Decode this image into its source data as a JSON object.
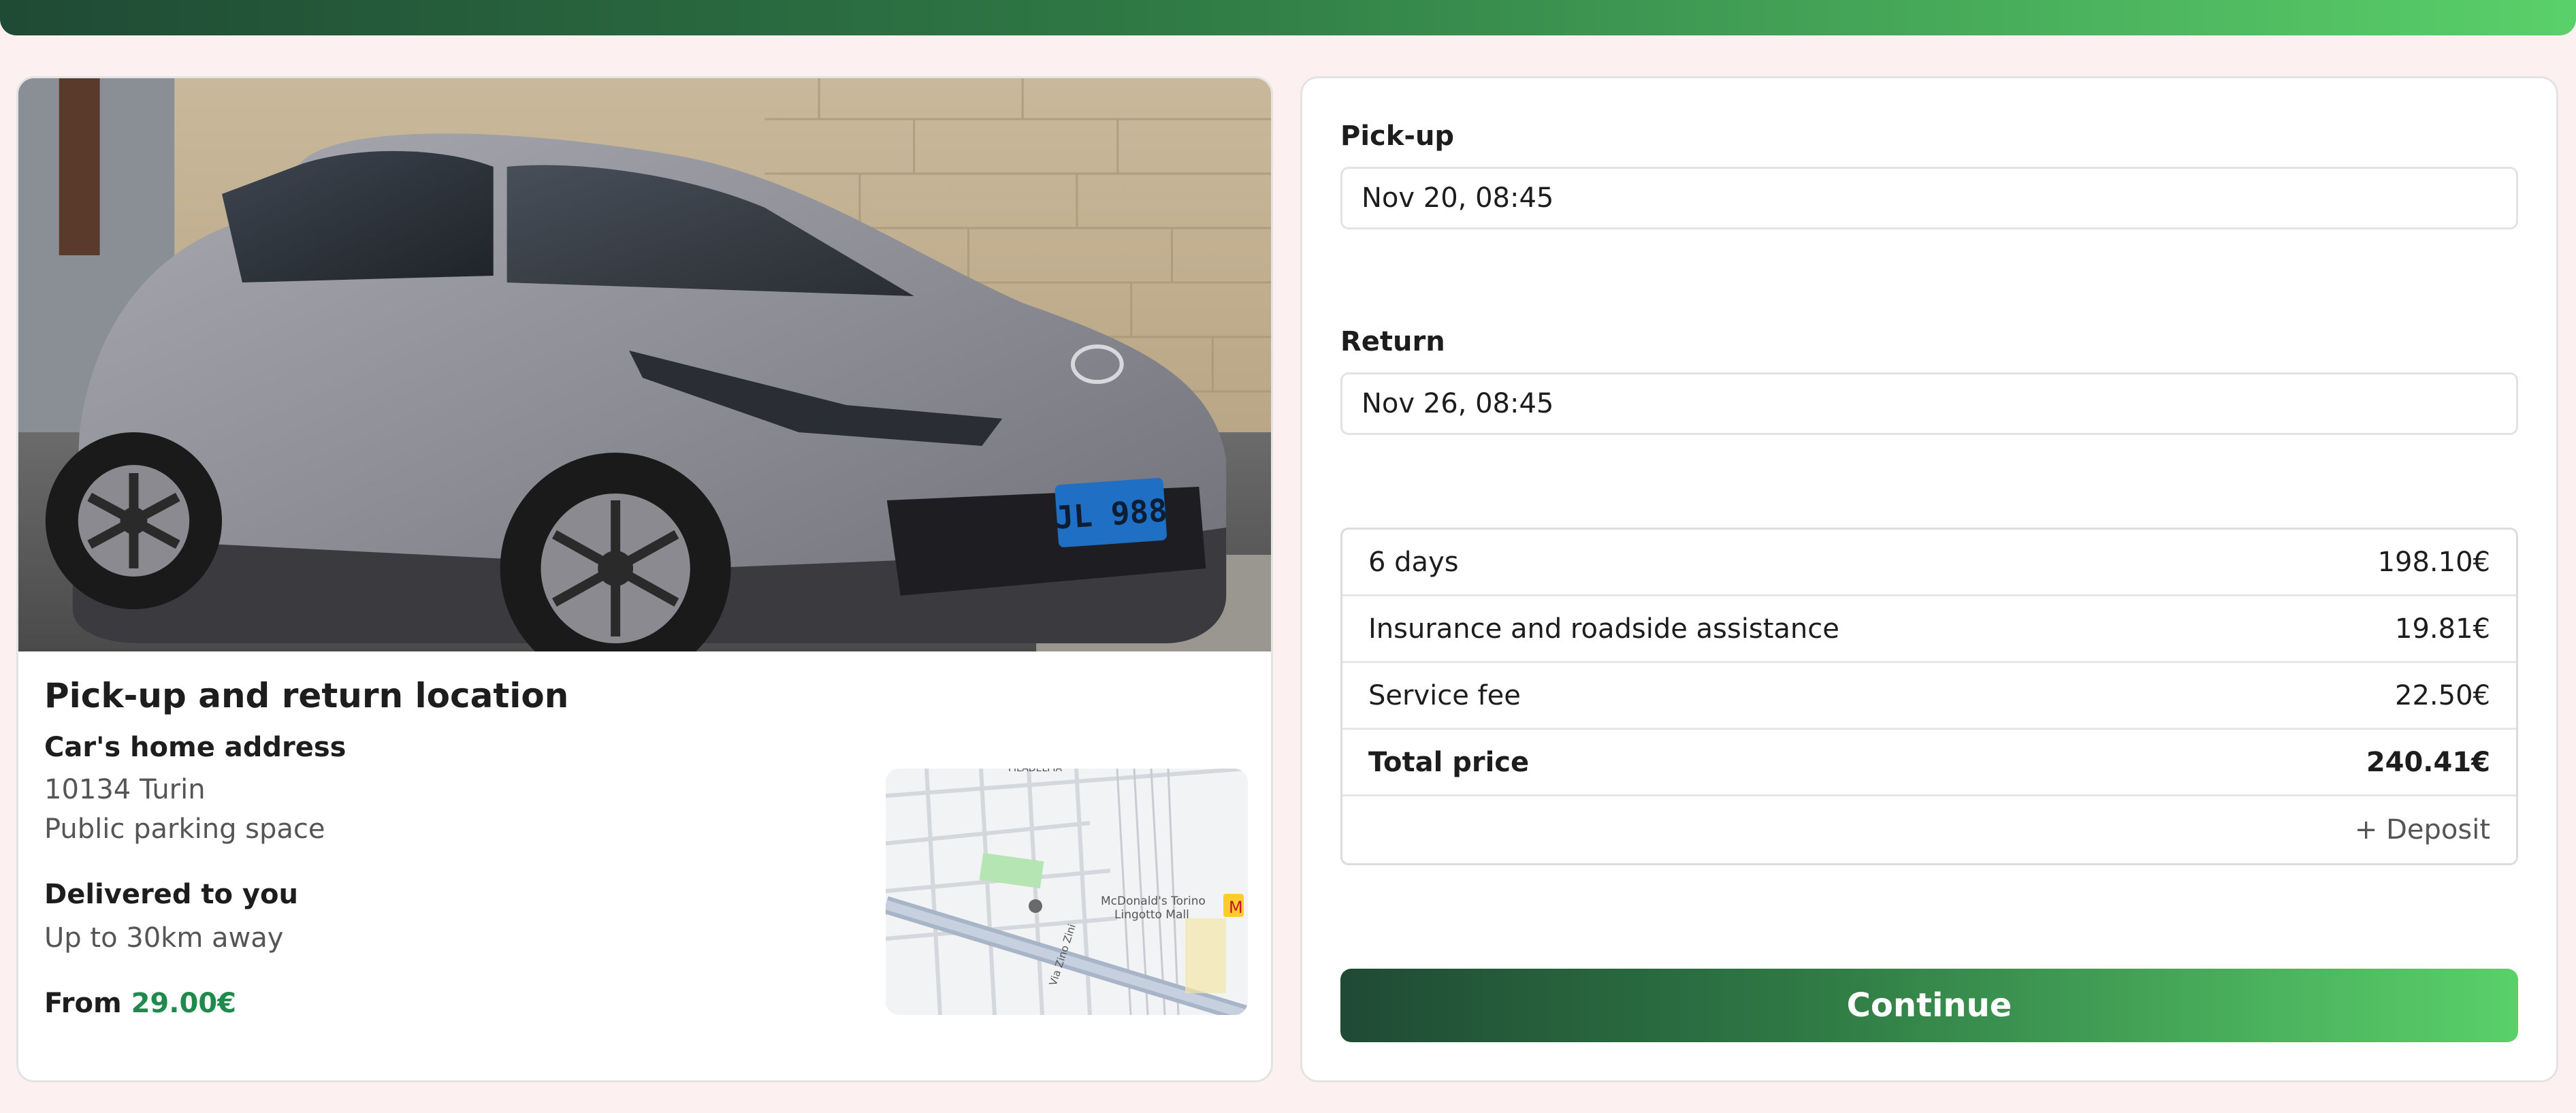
{
  "booking": {
    "location": {
      "title": "Pick-up and return location",
      "home_address_heading": "Car's home address",
      "address_line1": "10134 Turin",
      "address_line2": "Public parking space",
      "delivery_heading": "Delivered to you",
      "delivery_detail": "Up to 30km away",
      "from_label": "From",
      "from_price": "29.00€"
    },
    "map": {
      "labels": [
        "FILADELFIA",
        "McDonald's Torino",
        "Lingotto Mall",
        "Via Zino Zini"
      ],
      "icons": [
        "map-pin-icon",
        "mcdonalds-logo-icon"
      ]
    },
    "car_photo": {
      "plate": "JL 988"
    },
    "pickup": {
      "label": "Pick-up",
      "value": "Nov 20, 08:45"
    },
    "return": {
      "label": "Return",
      "value": "Nov 26, 08:45"
    },
    "price_rows": [
      {
        "label": "6 days",
        "amount": "198.10€"
      },
      {
        "label": "Insurance and roadside assistance",
        "amount": "19.81€"
      },
      {
        "label": "Service fee",
        "amount": "22.50€"
      },
      {
        "label": "Total price",
        "amount": "240.41€"
      }
    ],
    "deposit_label": "+ Deposit",
    "continue_label": "Continue"
  },
  "colors": {
    "accent_dark": "#1f4a34",
    "accent_light": "#5ad06a",
    "price_green": "#1f8a4c",
    "background": "#fdf0f0"
  }
}
